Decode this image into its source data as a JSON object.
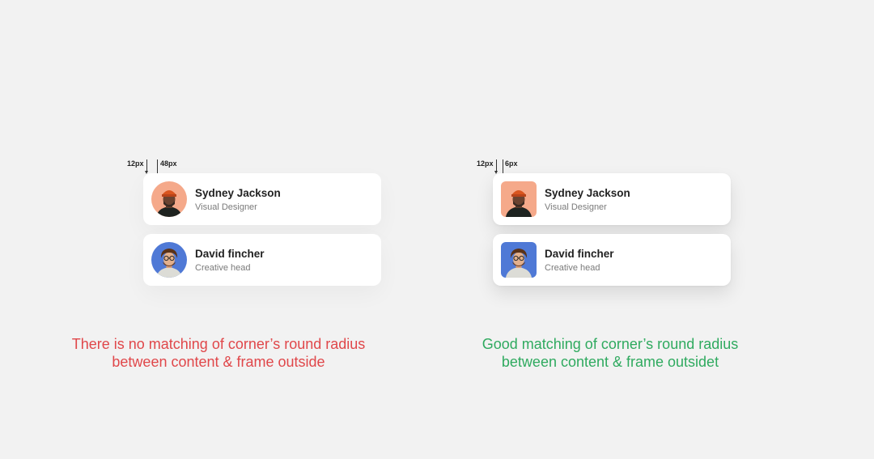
{
  "colors": {
    "background": "#f2f2f2",
    "card": "#ffffff",
    "bad_caption": "#e0474a",
    "good_caption": "#2faa5f",
    "avatar1_bg": "#f5a98a",
    "avatar2_bg": "#4f79d6"
  },
  "left": {
    "padding_label": "12px",
    "radius_label": "48px",
    "cards": [
      {
        "name": "Sydney Jackson",
        "role": "Visual Designer",
        "avatar_icon": "person-portrait-icon"
      },
      {
        "name": "David fincher",
        "role": "Creative head",
        "avatar_icon": "person-portrait-icon"
      }
    ],
    "caption_line1": "There is no matching of corner’s round radius",
    "caption_line2": "between content & frame outside"
  },
  "right": {
    "padding_label": "12px",
    "radius_label": "6px",
    "cards": [
      {
        "name": "Sydney Jackson",
        "role": "Visual Designer",
        "avatar_icon": "person-portrait-icon"
      },
      {
        "name": "David fincher",
        "role": "Creative head",
        "avatar_icon": "person-portrait-icon"
      }
    ],
    "caption_line1": "Good matching of corner’s round radius",
    "caption_line2": "between content & frame outsidet"
  }
}
